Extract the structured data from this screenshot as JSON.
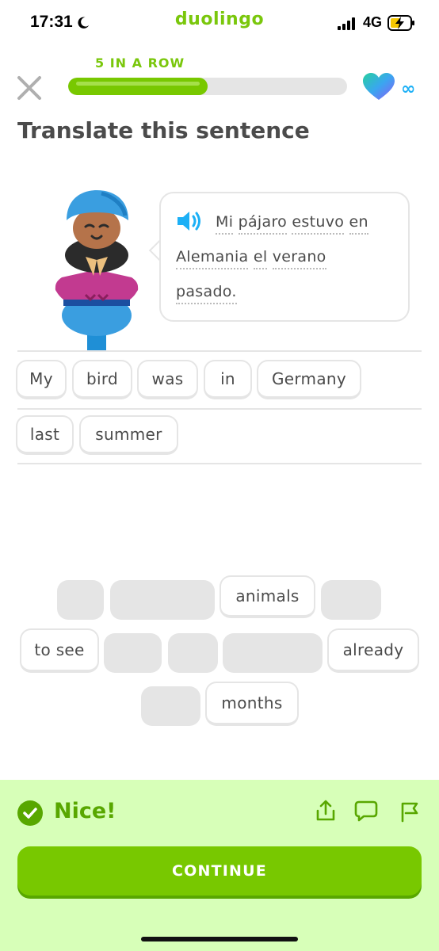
{
  "status_bar": {
    "time": "17:31",
    "brand": "duolingo",
    "network": "4G"
  },
  "header": {
    "streak_label": "5 IN A ROW",
    "progress": 0.5,
    "lives": "∞"
  },
  "title": "Translate this sentence",
  "prompt": {
    "line1": [
      "Mi",
      "pájaro",
      "estuvo",
      "en"
    ],
    "line2": [
      "Alemania",
      "el",
      "verano"
    ],
    "line3": [
      "pasado."
    ]
  },
  "answer_tiles": {
    "row1": [
      "My",
      "bird",
      "was",
      "in",
      "Germany"
    ],
    "row2": [
      "last",
      "summer"
    ]
  },
  "word_bank": {
    "animals": "animals",
    "to_see": "to see",
    "already": "already",
    "months": "months"
  },
  "feedback": {
    "message": "Nice!",
    "continue_label": "CONTINUE"
  },
  "colors": {
    "accent": "#78c800",
    "accent_dark": "#58a700",
    "footer_bg": "#d7ffb8",
    "speaker": "#1cb0f6"
  }
}
